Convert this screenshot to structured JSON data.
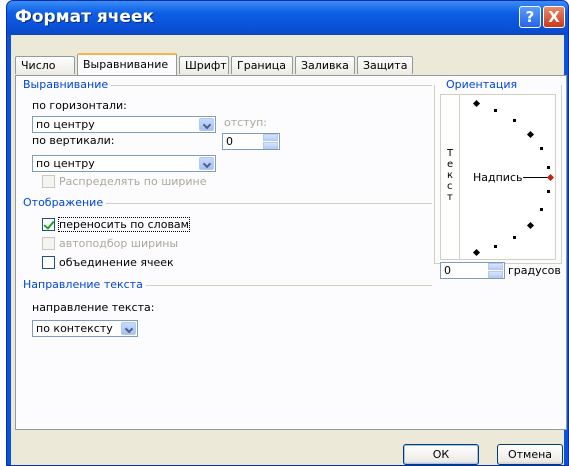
{
  "window": {
    "title": "Формат ячеек",
    "help_glyph": "?",
    "close_glyph": "X"
  },
  "tabs": [
    {
      "label": "Число",
      "active": false
    },
    {
      "label": "Выравнивание",
      "active": true
    },
    {
      "label": "Шрифт",
      "active": false
    },
    {
      "label": "Граница",
      "active": false
    },
    {
      "label": "Заливка",
      "active": false
    },
    {
      "label": "Защита",
      "active": false
    }
  ],
  "alignment": {
    "group_label": "Выравнивание",
    "horizontal_label": "по горизонтали:",
    "horizontal_value": "по центру",
    "indent_label": "отступ:",
    "indent_value": "0",
    "vertical_label": "по вертикали:",
    "vertical_value": "по центру",
    "distribute_label": "Распределять по ширине",
    "distribute_checked": false
  },
  "display": {
    "group_label": "Отображение",
    "wrap_label": "переносить по словам",
    "wrap_checked": true,
    "shrink_label": "автоподбор ширины",
    "shrink_checked": false,
    "merge_label": "объединение ячеек",
    "merge_checked": false
  },
  "text_direction": {
    "group_label": "Направление текста",
    "direction_label": "направление текста:",
    "direction_value": "по контексту"
  },
  "orientation": {
    "group_label": "Ориентация",
    "vertical_text": [
      "Т",
      "е",
      "к",
      "с",
      "т"
    ],
    "label": "Надпись",
    "degrees_value": "0",
    "degrees_label": "градусов"
  },
  "buttons": {
    "ok": "ОК",
    "cancel": "Отмена"
  },
  "colors": {
    "title_bar": "#0a52d8",
    "group_label": "#0046d5",
    "tab_highlight": "#f7b64c",
    "marker": "#c0201c"
  }
}
